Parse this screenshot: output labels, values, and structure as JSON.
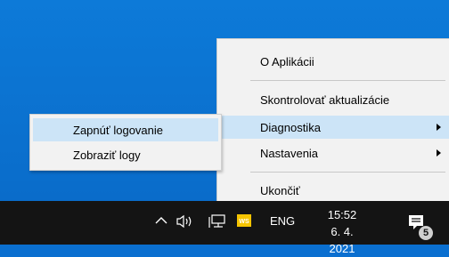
{
  "menu": {
    "items": [
      {
        "label": "O Aplikácii"
      },
      {
        "label": "Skontrolovať aktualizácie"
      },
      {
        "label": "Diagnostika"
      },
      {
        "label": "Nastavenia"
      },
      {
        "label": "Ukončiť"
      }
    ]
  },
  "submenu": {
    "items": [
      {
        "label": "Zapnúť logovanie"
      },
      {
        "label": "Zobraziť logy"
      }
    ]
  },
  "taskbar": {
    "language": "ENG",
    "time": "15:52",
    "date": "6. 4. 2021",
    "notification_count": "5",
    "ws_icon_label": "WS",
    "ws_icon_color": "#f5c400"
  },
  "colors": {
    "desktop": "#0a6fd0",
    "menu_bg": "#f2f2f2",
    "highlight": "#cce4f7",
    "taskbar": "#141414"
  }
}
